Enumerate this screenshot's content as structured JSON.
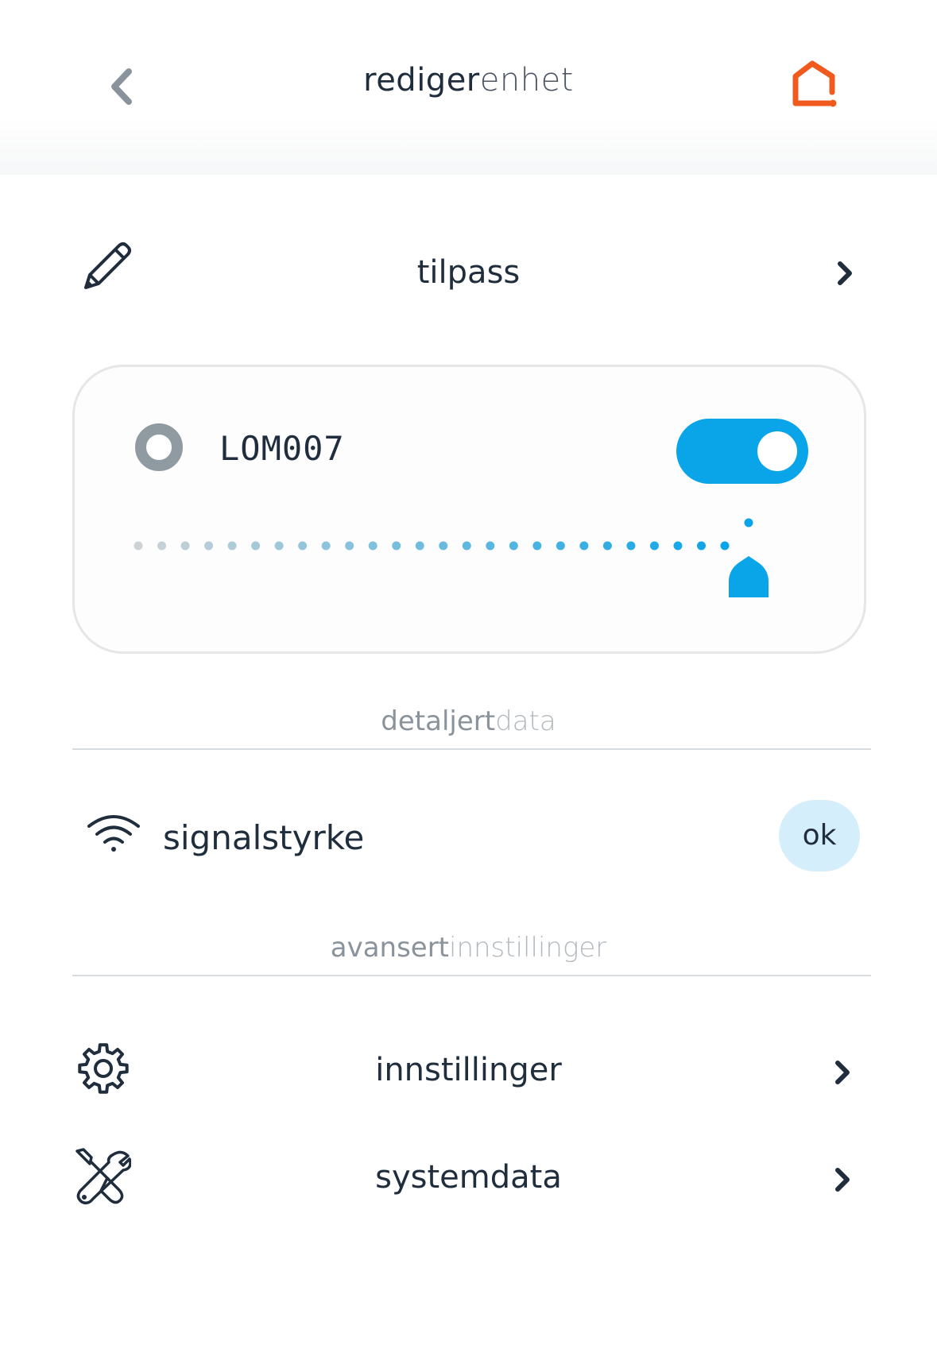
{
  "header": {
    "title_bold": "rediger",
    "title_light": "enhet",
    "back_icon": "chevron-left-icon",
    "home_icon": "home-alert-icon",
    "accent_color": "#f05a1e"
  },
  "customize": {
    "label": "tilpass",
    "icon": "pencil-icon"
  },
  "device": {
    "name": "LOM007",
    "status_icon": "status-ring-icon",
    "power_on": true,
    "level_fraction": 1.0,
    "accent_color": "#0aa4e8"
  },
  "detailed_section": {
    "title_bold": "detaljert",
    "title_light": "data"
  },
  "signal": {
    "label": "signalstyrke",
    "status": "ok",
    "icon": "wifi-icon"
  },
  "advanced_section": {
    "title_bold": "avansert",
    "title_light": "innstillinger"
  },
  "menu": [
    {
      "label": "innstillinger",
      "icon": "gear-icon"
    },
    {
      "label": "systemdata",
      "icon": "tools-icon"
    }
  ]
}
